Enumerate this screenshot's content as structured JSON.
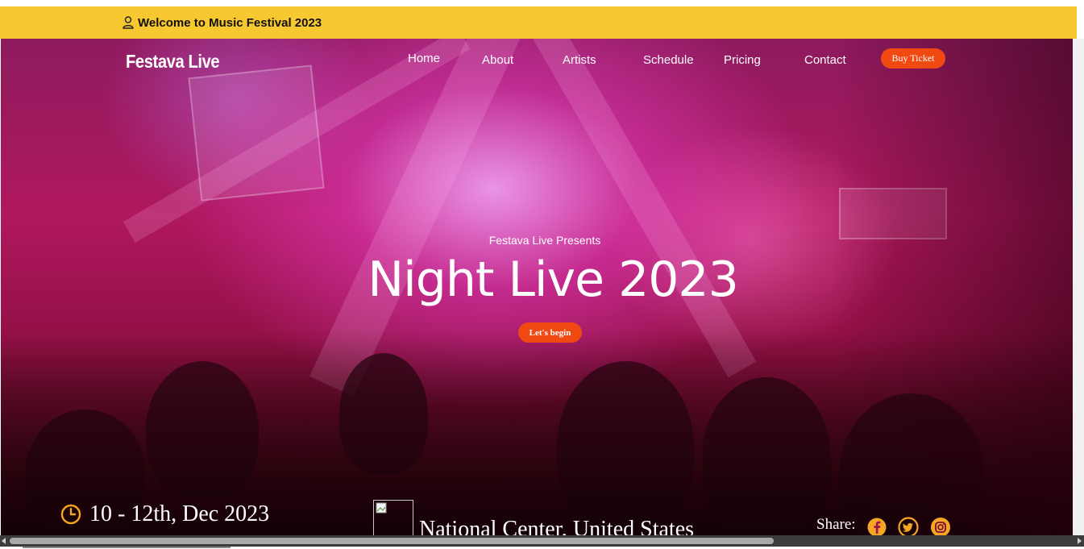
{
  "topbar": {
    "welcome_text": "Welcome to Music Festival 2023",
    "icon": "user-icon"
  },
  "nav": {
    "logo": "Festava Live",
    "links": [
      "Home",
      "About",
      "Artists",
      "Schedule",
      "Pricing",
      "Contact"
    ],
    "buy_button": "Buy Ticket"
  },
  "hero": {
    "presents": "Festava Live Presents",
    "title": "Night Live 2023",
    "cta": "Let's begin"
  },
  "info": {
    "date": "10 - 12th, Dec 2023",
    "date_icon": "clock-icon",
    "location": "National Center, United States",
    "share_label": "Share:",
    "social_icons": [
      "facebook-icon",
      "twitter-icon",
      "instagram-icon"
    ]
  },
  "colors": {
    "topbar_bg": "#f7c830",
    "accent_button": "#f04a12",
    "social_icon": "#f5a623",
    "hero_tint": "#b0185f"
  }
}
